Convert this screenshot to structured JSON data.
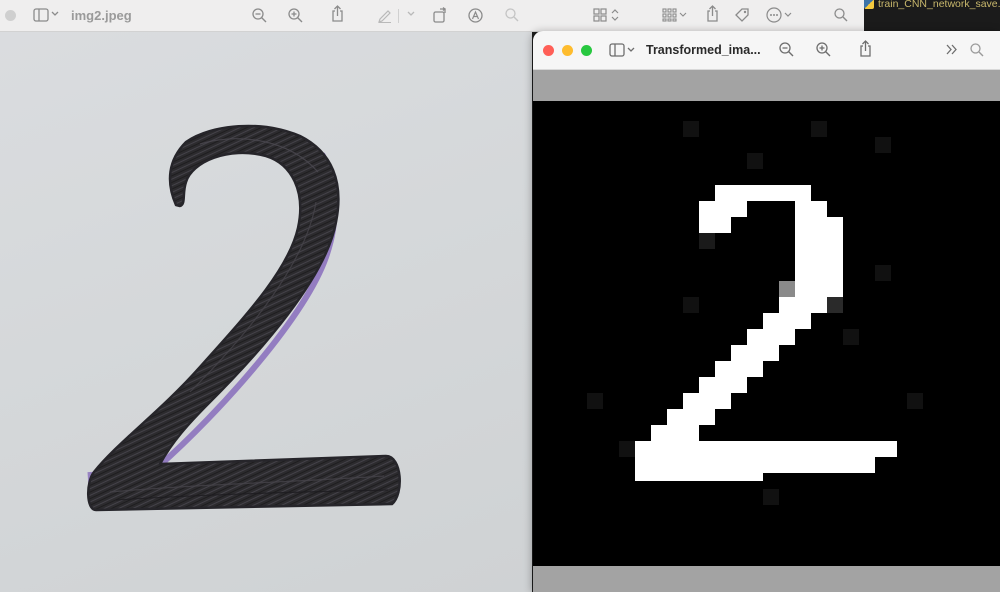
{
  "left_window": {
    "title": "img2.jpeg",
    "toolbar_icons": [
      "sidebar-icon",
      "chevron-down-icon",
      "zoom-out-icon",
      "zoom-in-icon",
      "share-icon",
      "markup-pen-icon",
      "chevron-down-icon",
      "rotate-icon",
      "annotate-icon",
      "search-icon"
    ],
    "image_content": "handwritten digit 2"
  },
  "right_strip": {
    "toolbar_icons": [
      "grid-view-icon",
      "sort-arrows-icon",
      "group-icon",
      "share-icon",
      "tag-icon",
      "more-icon",
      "search-icon"
    ]
  },
  "editor_tab": {
    "label": "train_CNN_network_save.p"
  },
  "front_window": {
    "title": "Transformed_ima...",
    "traffic_lights": {
      "close": "#ff5f57",
      "minimize": "#febc2e",
      "zoom": "#28c840"
    },
    "toolbar_icons": [
      "sidebar-icon",
      "chevron-down-icon",
      "zoom-out-icon",
      "zoom-in-icon",
      "share-icon",
      "overflow-chevrons-icon",
      "search-icon"
    ],
    "image_content": "pixelated white digit 2 on black"
  }
}
